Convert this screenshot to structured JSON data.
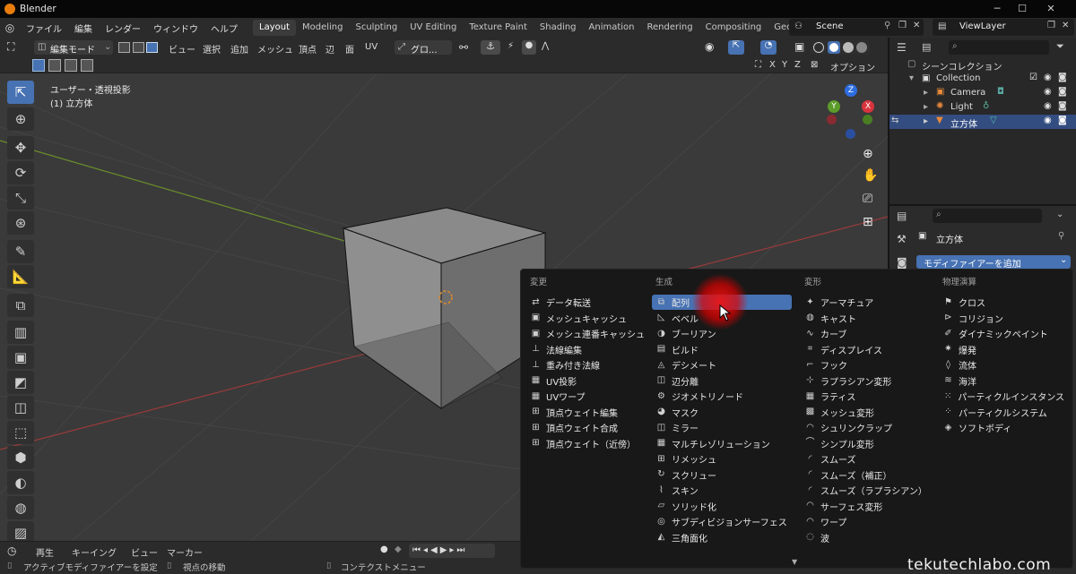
{
  "window": {
    "title": "Blender",
    "controls": [
      "─",
      "☐",
      "✕"
    ]
  },
  "menubar": {
    "menus": [
      "ファイル",
      "編集",
      "レンダー",
      "ウィンドウ",
      "ヘルプ"
    ],
    "workspaces": [
      "Layout",
      "Modeling",
      "Sculpting",
      "UV Editing",
      "Texture Paint",
      "Shading",
      "Animation",
      "Rendering",
      "Compositing",
      "Geometry Node"
    ],
    "active_workspace": "Layout",
    "scene": "Scene",
    "view_layer": "ViewLayer"
  },
  "viewport_header": {
    "mode": "編集モード",
    "menus": [
      "ビュー",
      "選択",
      "追加",
      "メッシュ",
      "頂点",
      "辺",
      "面",
      "UV"
    ],
    "transform": "グロ...",
    "axes": [
      "X",
      "Y",
      "Z"
    ],
    "options": "オプション"
  },
  "viewport": {
    "view_name": "ユーザー・透視投影",
    "object_name": "(1) 立方体",
    "gizmo_axes": [
      "Z",
      "Y",
      "X"
    ]
  },
  "outliner": {
    "root": "シーンコレクション",
    "items": [
      {
        "label": "Collection",
        "selected": false
      },
      {
        "label": "Camera",
        "selected": false
      },
      {
        "label": "Light",
        "selected": false
      },
      {
        "label": "立方体",
        "selected": true
      }
    ]
  },
  "properties": {
    "object_name": "立方体",
    "add_modifier": "モディファイアーを追加"
  },
  "modifier_menu": {
    "columns": [
      {
        "header": "変更",
        "items": [
          {
            "icon": "data-transfer-icon",
            "label": "データ転送"
          },
          {
            "icon": "mesh-cache-icon",
            "label": "メッシュキャッシュ"
          },
          {
            "icon": "mesh-sequence-cache-icon",
            "label": "メッシュ連番キャッシュ"
          },
          {
            "icon": "normal-edit-icon",
            "label": "法線編集"
          },
          {
            "icon": "weighted-normal-icon",
            "label": "重み付き法線"
          },
          {
            "icon": "uv-project-icon",
            "label": "UV投影"
          },
          {
            "icon": "uv-warp-icon",
            "label": "UVワープ"
          },
          {
            "icon": "vertex-weight-edit-icon",
            "label": "頂点ウェイト編集"
          },
          {
            "icon": "vertex-weight-mix-icon",
            "label": "頂点ウェイト合成"
          },
          {
            "icon": "vertex-weight-proximity-icon",
            "label": "頂点ウェイト（近傍）"
          }
        ]
      },
      {
        "header": "生成",
        "items": [
          {
            "icon": "array-icon",
            "label": "配列",
            "highlighted": true
          },
          {
            "icon": "bevel-icon",
            "label": "ベベル"
          },
          {
            "icon": "boolean-icon",
            "label": "ブーリアン"
          },
          {
            "icon": "build-icon",
            "label": "ビルド"
          },
          {
            "icon": "decimate-icon",
            "label": "デシメート"
          },
          {
            "icon": "edge-split-icon",
            "label": "辺分離"
          },
          {
            "icon": "geometry-nodes-icon",
            "label": "ジオメトリノード"
          },
          {
            "icon": "mask-icon",
            "label": "マスク"
          },
          {
            "icon": "mirror-icon",
            "label": "ミラー"
          },
          {
            "icon": "multires-icon",
            "label": "マルチレゾリューション"
          },
          {
            "icon": "remesh-icon",
            "label": "リメッシュ"
          },
          {
            "icon": "screw-icon",
            "label": "スクリュー"
          },
          {
            "icon": "skin-icon",
            "label": "スキン"
          },
          {
            "icon": "solidify-icon",
            "label": "ソリッド化"
          },
          {
            "icon": "subdivision-icon",
            "label": "サブディビジョンサーフェス"
          },
          {
            "icon": "triangulate-icon",
            "label": "三角面化"
          }
        ]
      },
      {
        "header": "変形",
        "items": [
          {
            "icon": "armature-icon",
            "label": "アーマチュア"
          },
          {
            "icon": "cast-icon",
            "label": "キャスト"
          },
          {
            "icon": "curve-icon",
            "label": "カーブ"
          },
          {
            "icon": "displace-icon",
            "label": "ディスプレイス"
          },
          {
            "icon": "hook-icon",
            "label": "フック"
          },
          {
            "icon": "laplacian-deform-icon",
            "label": "ラプラシアン変形"
          },
          {
            "icon": "lattice-icon",
            "label": "ラティス"
          },
          {
            "icon": "mesh-deform-icon",
            "label": "メッシュ変形"
          },
          {
            "icon": "shrinkwrap-icon",
            "label": "シュリンクラップ"
          },
          {
            "icon": "simple-deform-icon",
            "label": "シンプル変形"
          },
          {
            "icon": "smooth-icon",
            "label": "スムーズ"
          },
          {
            "icon": "smooth-corrective-icon",
            "label": "スムーズ（補正）"
          },
          {
            "icon": "smooth-laplacian-icon",
            "label": "スムーズ（ラプラシアン）"
          },
          {
            "icon": "surface-deform-icon",
            "label": "サーフェス変形"
          },
          {
            "icon": "warp-icon",
            "label": "ワープ"
          },
          {
            "icon": "wave-icon",
            "label": "波"
          }
        ]
      },
      {
        "header": "物理演算",
        "items": [
          {
            "icon": "cloth-icon",
            "label": "クロス"
          },
          {
            "icon": "collision-icon",
            "label": "コリジョン"
          },
          {
            "icon": "dynamic-paint-icon",
            "label": "ダイナミックペイント"
          },
          {
            "icon": "explode-icon",
            "label": "爆発"
          },
          {
            "icon": "fluid-icon",
            "label": "流体"
          },
          {
            "icon": "ocean-icon",
            "label": "海洋"
          },
          {
            "icon": "particle-instance-icon",
            "label": "パーティクルインスタンス"
          },
          {
            "icon": "particle-system-icon",
            "label": "パーティクルシステム"
          },
          {
            "icon": "soft-body-icon",
            "label": "ソフトボディ"
          }
        ]
      }
    ]
  },
  "timeline": {
    "items": [
      "再生",
      "キーイング",
      "ビュー",
      "マーカー"
    ]
  },
  "statusbar": {
    "items": [
      "アクティブモディファイアーを設定",
      "視点の移動",
      "コンテクストメニュー"
    ]
  },
  "watermark": "tekutechlabo.com",
  "colors": {
    "accent": "#4772b3",
    "selected_row": "#334d80",
    "cursor_glow": "#e01010"
  }
}
